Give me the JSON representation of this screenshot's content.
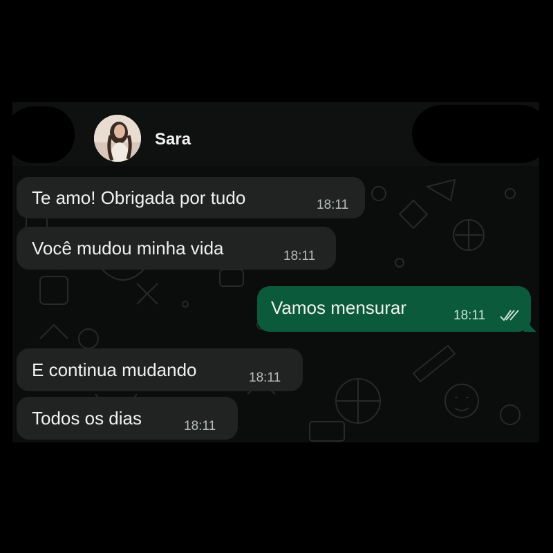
{
  "contact": {
    "name": "Sara"
  },
  "messages": [
    {
      "direction": "incoming",
      "text": "Te amo! Obrigada por tudo",
      "time": "18:11"
    },
    {
      "direction": "incoming",
      "text": "Você mudou minha vida",
      "time": "18:11"
    },
    {
      "direction": "outgoing",
      "text": "Vamos mensurar",
      "time": "18:11",
      "status": "read-double-check"
    },
    {
      "direction": "incoming",
      "text": "E continua mudando",
      "time": "18:11"
    },
    {
      "direction": "incoming",
      "text": "Todos os dias",
      "time": "18:11"
    }
  ],
  "colors": {
    "incoming_bubble": "#202322",
    "outgoing_bubble": "#0b5a3b",
    "chat_background": "#0b0d0c"
  },
  "icons": [
    "back-arrow-icon-redacted",
    "avatar",
    "double-check-icon"
  ]
}
